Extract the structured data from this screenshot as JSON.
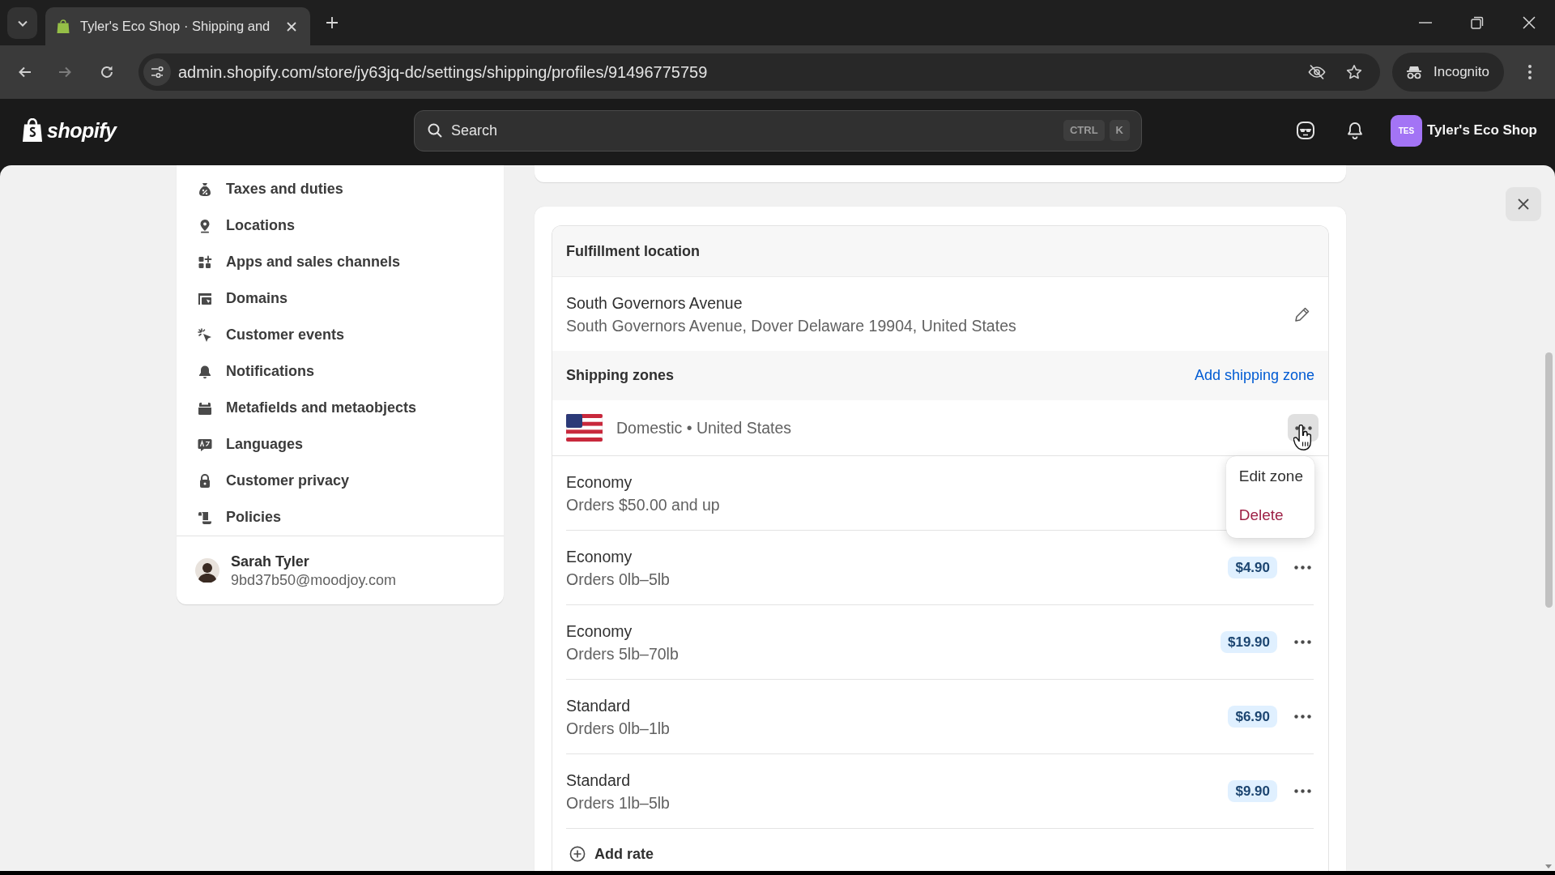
{
  "browser": {
    "tabs": [
      {
        "title": "Tyler's Eco Shop · Shipping and",
        "selected": true
      }
    ],
    "url": "admin.shopify.com/store/jy63jq-dc/settings/shipping/profiles/91496775759",
    "profile": "Incognito"
  },
  "header": {
    "logo": "shopify",
    "search": {
      "placeholder": "Search",
      "shortcut": [
        "CTRL",
        "K"
      ]
    },
    "store": {
      "initials": "TES",
      "name": "Tyler's Eco Shop"
    }
  },
  "sidebar": {
    "items": [
      "Taxes and duties",
      "Locations",
      "Apps and sales channels",
      "Domains",
      "Customer events",
      "Notifications",
      "Metafields and metaobjects",
      "Languages",
      "Customer privacy",
      "Policies"
    ],
    "user": {
      "name": "Sarah Tyler",
      "email": "9bd37b50@moodjoy.com"
    }
  },
  "fulfillment": {
    "title": "Fulfillment location",
    "location": {
      "name": "South Governors Avenue",
      "address": "South Governors Avenue, Dover Delaware 19904, United States"
    }
  },
  "shipping_zones": {
    "title": "Shipping zones",
    "action": "Add shipping zone",
    "zone": {
      "name": "Domestic • United States",
      "expanded": true,
      "menu": [
        {
          "label": "Edit zone",
          "kind": "default"
        },
        {
          "label": "Delete",
          "kind": "destructive"
        }
      ]
    },
    "rates": [
      {
        "name": "Economy",
        "condition": "Orders $50.00 and up"
      },
      {
        "name": "Economy",
        "condition": "Orders 0lb–5lb",
        "price": "$4.90"
      },
      {
        "name": "Economy",
        "condition": "Orders 5lb–70lb",
        "price": "$19.90"
      },
      {
        "name": "Standard",
        "condition": "Orders 0lb–1lb",
        "price": "$6.90"
      },
      {
        "name": "Standard",
        "condition": "Orders 1lb–5lb",
        "price": "$9.90"
      }
    ],
    "add_rate": "Add rate"
  }
}
